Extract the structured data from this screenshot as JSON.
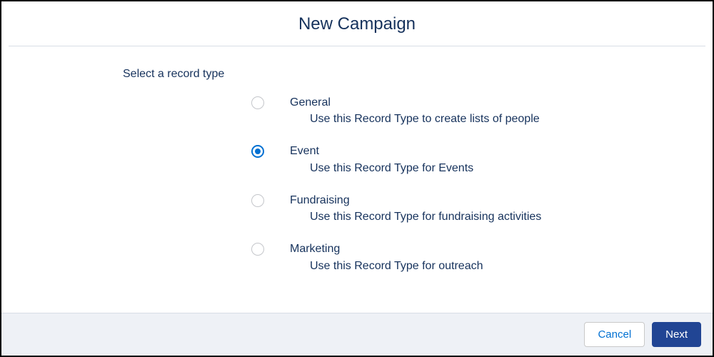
{
  "modal": {
    "title": "New Campaign",
    "prompt": "Select a record type",
    "options": [
      {
        "label": "General",
        "description": "Use this Record Type to create lists of people",
        "selected": false
      },
      {
        "label": "Event",
        "description": "Use this Record Type for Events",
        "selected": true
      },
      {
        "label": "Fundraising",
        "description": "Use this Record Type for fundraising activities",
        "selected": false
      },
      {
        "label": "Marketing",
        "description": "Use this Record Type for outreach",
        "selected": false
      }
    ],
    "buttons": {
      "cancel": "Cancel",
      "next": "Next"
    }
  }
}
